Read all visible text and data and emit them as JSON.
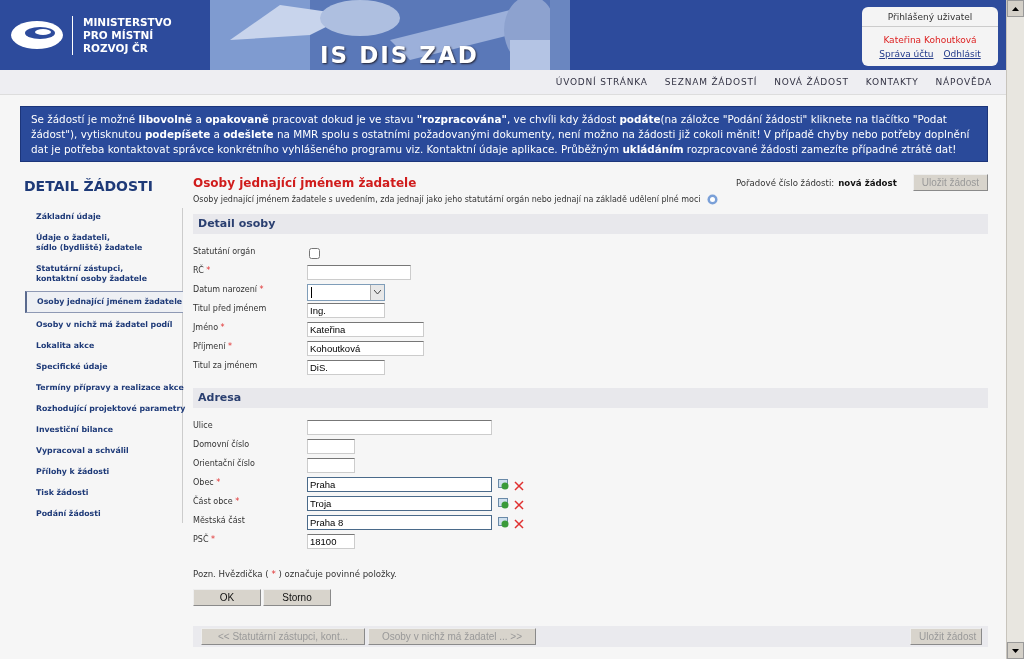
{
  "header": {
    "org_name": [
      "MINISTERSTVO",
      "PRO MÍSTNÍ",
      "ROZVOJ ČR"
    ],
    "banner_title": "IS DIS ZAD",
    "user_box": {
      "label": "Přihlášený uživatel",
      "user": "Kateřina Kohoutková",
      "links": [
        "Správa účtu",
        "Odhlásit"
      ]
    }
  },
  "nav": [
    "ÚVODNÍ STRÁNKA",
    "SEZNAM ŽÁDOSTÍ",
    "NOVÁ ŽÁDOST",
    "KONTAKTY",
    "NÁPOVĚDA"
  ],
  "notice": "Se žádostí je možné **libovolně** a **opakovaně** pracovat dokud je ve stavu **\"rozpracována\"**, ve chvíli kdy žádost **podáte**(na záložce \"Podání žádosti\" kliknete na tlačítko \"Podat žádost\"), vytisknutou **podepíšete** a **odešlete** na MMR spolu s ostatními požadovanými dokumenty, není možno na žádosti již cokoli měnit! V případě chyby nebo potřeby doplnění dat je potřeba kontaktovat správce konkrétního vyhlášeného programu viz. Kontaktní údaje aplikace. Průběžným **ukládáním** rozpracované žádosti zamezíte případné ztrátě dat!",
  "sidebar": {
    "title": "DETAIL ŽÁDOSTI",
    "items": [
      {
        "label": "Základní údaje",
        "selected": false
      },
      {
        "label": "Údaje o žadateli,\nsídlo (bydliště) žadatele",
        "selected": false
      },
      {
        "label": "Statutární zástupci,\nkontaktní osoby žadatele",
        "selected": false
      },
      {
        "label": "Osoby jednající jménem žadatele",
        "selected": true
      },
      {
        "label": "Osoby v nichž má žadatel podíl",
        "selected": false
      },
      {
        "label": "Lokalita akce",
        "selected": false
      },
      {
        "label": "Specifické údaje",
        "selected": false
      },
      {
        "label": "Termíny přípravy a realizace akce",
        "selected": false
      },
      {
        "label": "Rozhodující projektové parametry",
        "selected": false
      },
      {
        "label": "Investiční bilance",
        "selected": false
      },
      {
        "label": "Vypracoval a schválil",
        "selected": false
      },
      {
        "label": "Přílohy k žádosti",
        "selected": false
      },
      {
        "label": "Tisk žádosti",
        "selected": false
      },
      {
        "label": "Podání žádosti",
        "selected": false
      }
    ]
  },
  "content": {
    "title": "Osoby jednající jménem žadatele",
    "subtitle": "Osoby jednající jménem žadatele s uvedením, zda jednají jako jeho statutární orgán nebo jednají na základě udělení plné moci",
    "order_label": "Pořadové číslo žádosti:",
    "order_value": "nová žádost",
    "save_top": {
      "label": "Uložit žádost",
      "disabled": true
    },
    "sections": [
      {
        "title": "Detail osoby",
        "fields": [
          {
            "kind": "checkbox",
            "label": "Statutání orgán",
            "required": false,
            "checked": false
          },
          {
            "kind": "text",
            "label": "RČ",
            "required": true
          },
          {
            "kind": "date",
            "label": "Datum narození",
            "required": true
          },
          {
            "kind": "text",
            "label": "Titul před jménem",
            "required": false,
            "value": "Ing."
          },
          {
            "kind": "text",
            "label": "Jméno",
            "required": true,
            "value": "Kateřina"
          },
          {
            "kind": "text",
            "label": "Příjmení",
            "required": true,
            "value": "Kohoutková"
          },
          {
            "kind": "text",
            "label": "Titul za jménem",
            "required": false,
            "value": "DiS."
          }
        ]
      },
      {
        "title": "Adresa",
        "fields": [
          {
            "kind": "text",
            "label": "Ulice",
            "required": false
          },
          {
            "kind": "text",
            "label": "Domovní číslo",
            "required": false
          },
          {
            "kind": "text",
            "label": "Orientační číslo",
            "required": false
          },
          {
            "kind": "lookup",
            "label": "Obec",
            "required": true,
            "value": "Praha"
          },
          {
            "kind": "lookup",
            "label": "Část obce",
            "required": true,
            "value": "Troja"
          },
          {
            "kind": "lookup",
            "label": "Městská část",
            "required": false,
            "value": "Praha 8"
          },
          {
            "kind": "text",
            "label": "PSČ",
            "required": true,
            "value": "18100"
          }
        ]
      }
    ],
    "note_before": "Pozn. Hvězdička (",
    "note_mark": "*",
    "note_after": ") označuje povinné položky.",
    "buttons": [
      "OK",
      "Storno"
    ],
    "bottom": {
      "prev": {
        "label": "<<  Statutární zástupci, kont...",
        "disabled": true
      },
      "next": {
        "label": "Osoby v nichž má žadatel ... >>",
        "disabled": true
      },
      "save": {
        "label": "Uložit žádost",
        "disabled": true
      }
    }
  }
}
